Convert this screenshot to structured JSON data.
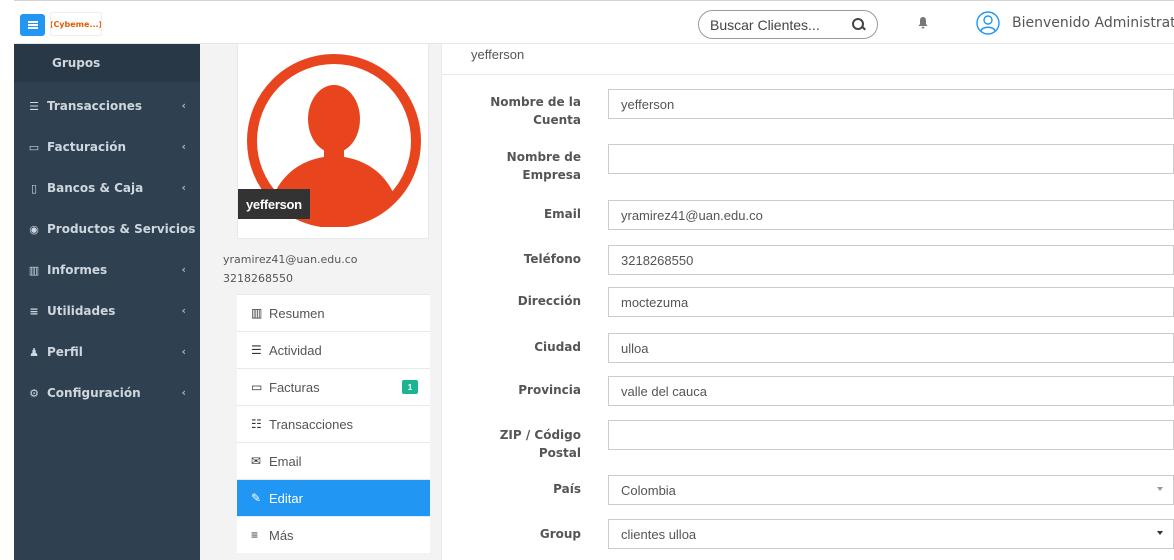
{
  "topbar": {
    "logo_text": "(Cybeme...)",
    "search_placeholder": "Buscar Clientes...",
    "welcome": "Bienvenido Administrator"
  },
  "sidebar": {
    "active_group": "Grupos",
    "items": [
      {
        "label": "Transacciones",
        "icon": "database-icon"
      },
      {
        "label": "Facturación",
        "icon": "credit-card-icon"
      },
      {
        "label": "Bancos & Caja",
        "icon": "building-icon"
      },
      {
        "label": "Productos & Servicios",
        "icon": "cube-icon"
      },
      {
        "label": "Informes",
        "icon": "bar-chart-icon"
      },
      {
        "label": "Utilidades",
        "icon": "align-icon"
      },
      {
        "label": "Perfil",
        "icon": "user-icon"
      },
      {
        "label": "Configuración",
        "icon": "cogs-icon"
      }
    ]
  },
  "profile": {
    "name": "yefferson",
    "email": "yramirez41@uan.edu.co",
    "phone": "3218268550"
  },
  "menu": [
    {
      "label": "Resumen",
      "icon": "bar-chart-icon"
    },
    {
      "label": "Actividad",
      "icon": "tasks-icon"
    },
    {
      "label": "Facturas",
      "icon": "credit-card-icon",
      "badge": "1"
    },
    {
      "label": "Transacciones",
      "icon": "list-icon"
    },
    {
      "label": "Email",
      "icon": "envelope-icon"
    },
    {
      "label": "Editar",
      "icon": "pencil-icon",
      "active": true
    },
    {
      "label": "Más",
      "icon": "bars-icon"
    }
  ],
  "form": {
    "title": "yefferson",
    "fields": {
      "account_name": {
        "label": "Nombre de la Cuenta",
        "value": "yefferson"
      },
      "company": {
        "label": "Nombre de Empresa",
        "value": ""
      },
      "email": {
        "label": "Email",
        "value": "yramirez41@uan.edu.co"
      },
      "phone": {
        "label": "Teléfono",
        "value": "3218268550"
      },
      "address": {
        "label": "Dirección",
        "value": "moctezuma"
      },
      "city": {
        "label": "Ciudad",
        "value": "ulloa"
      },
      "province": {
        "label": "Provincia",
        "value": "valle del cauca"
      },
      "zip": {
        "label": "ZIP / Código Postal",
        "value": ""
      },
      "country": {
        "label": "País",
        "value": "Colombia"
      },
      "group": {
        "label": "Group",
        "value": "clientes ulloa"
      }
    }
  },
  "colors": {
    "sidebar_bg": "#2f4050",
    "accent": "#2196f3",
    "avatar": "#e8451e",
    "badge": "#1ab394"
  }
}
